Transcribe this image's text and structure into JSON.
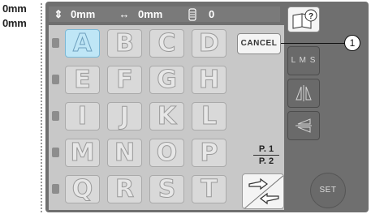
{
  "side_values": {
    "top": "0mm",
    "bottom": "0mm"
  },
  "header": {
    "height_value": "0mm",
    "width_value": "0mm",
    "stitch_count": "0"
  },
  "alphabet_rows": [
    [
      "A",
      "B",
      "C",
      "D"
    ],
    [
      "E",
      "F",
      "G",
      "H"
    ],
    [
      "I",
      "J",
      "K",
      "L"
    ],
    [
      "M",
      "N",
      "O",
      "P"
    ],
    [
      "Q",
      "R",
      "S",
      "T"
    ]
  ],
  "selected_letter": "A",
  "buttons": {
    "cancel": "CANCEL",
    "lms": "L M S",
    "set": "SET"
  },
  "page": {
    "current": "P. 1",
    "total": "P. 2"
  },
  "callout": "1",
  "colors": {
    "screen_bg": "#6f6f6f",
    "panel_bg": "#c8c8c8",
    "tile_bg": "#d9d9d9",
    "selected_tile": "#bfe6f6"
  },
  "icons": [
    "height-arrows-icon",
    "width-arrows-icon",
    "spool-icon",
    "help-book-icon",
    "mirror-icon",
    "flip-icon",
    "page-arrows-icon"
  ]
}
